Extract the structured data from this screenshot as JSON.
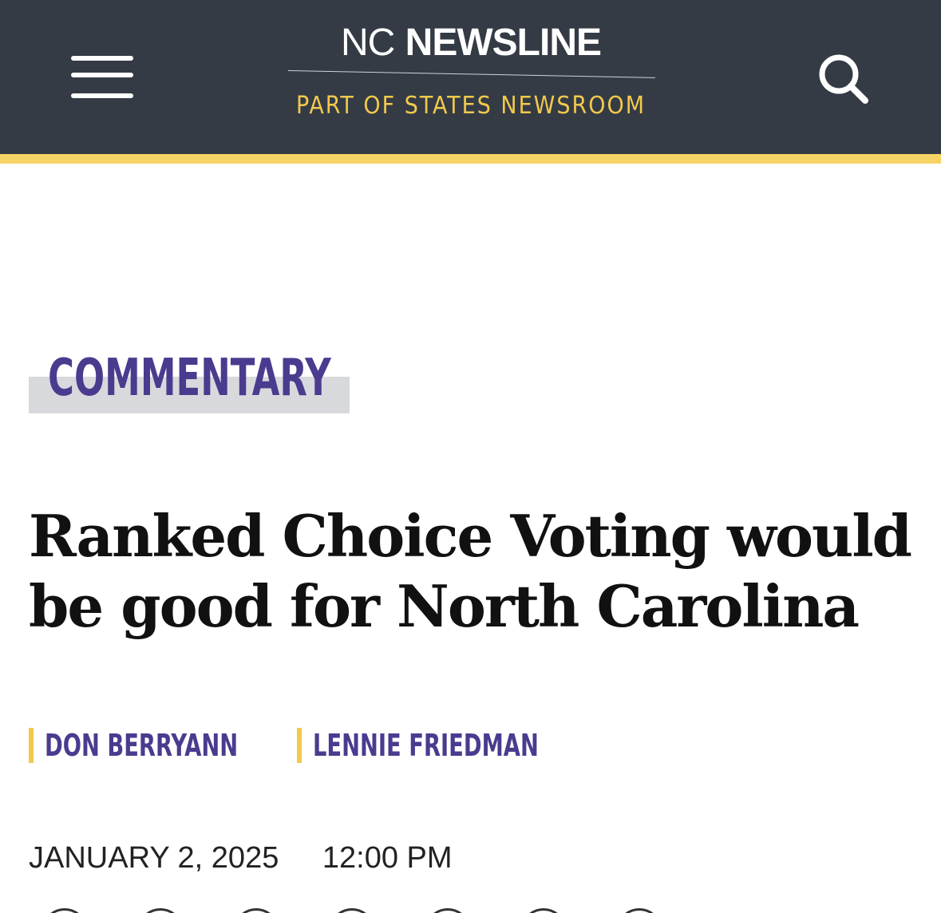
{
  "header": {
    "logo_prefix": "NC",
    "logo_name": "NEWSLINE",
    "tagline": "PART OF STATES NEWSROOM",
    "menu_icon": "hamburger-menu-icon",
    "search_icon": "search-icon",
    "background_color": "#343b45",
    "accent_color": "#f6d365"
  },
  "article": {
    "category": "COMMENTARY",
    "headline": "Ranked Choice Voting would be good for North Carolina",
    "authors": [
      "DON BERRYANN",
      "LENNIE FRIEDMAN"
    ],
    "date": "JANUARY 2, 2025",
    "time": "12:00 PM",
    "category_color": "#4b3b8f"
  },
  "share_icons": [
    "share-icon",
    "share-icon",
    "share-icon",
    "share-icon",
    "share-icon",
    "share-icon",
    "share-icon"
  ]
}
